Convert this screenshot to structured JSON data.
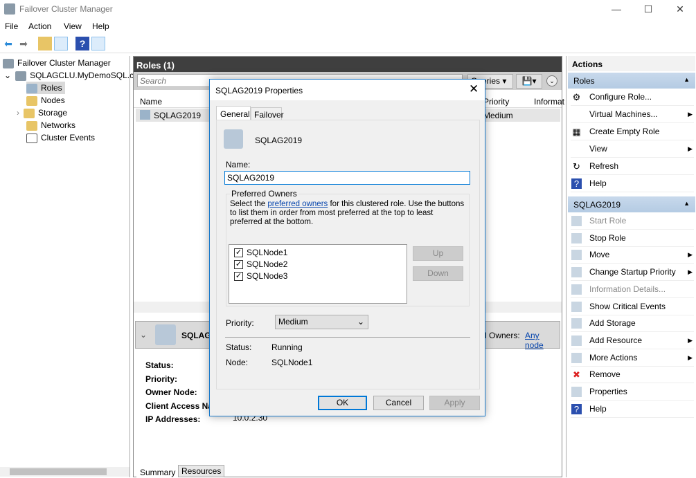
{
  "window": {
    "title": "Failover Cluster Manager",
    "min": "—",
    "max": "☐",
    "close": "✕"
  },
  "menu": [
    "File",
    "Action",
    "View",
    "Help"
  ],
  "tree": {
    "root": "Failover Cluster Manager",
    "cluster": "SQLAGCLU.MyDemoSQL.co",
    "items": [
      "Roles",
      "Nodes",
      "Storage",
      "Networks",
      "Cluster Events"
    ]
  },
  "roles": {
    "header": "Roles (1)",
    "search_placeholder": "Search",
    "queries": "Queries",
    "columns": [
      "Name",
      "Priority",
      "Informat"
    ],
    "rows": [
      {
        "name": "SQLAG2019",
        "priority": "Medium"
      }
    ]
  },
  "detail": {
    "name": "SQLAG2019",
    "owners_label": "d Owners:",
    "owners_link": "Any node",
    "labels": [
      "Status:",
      "Priority:",
      "Owner Node:",
      "Client Access Na",
      "IP Addresses:"
    ],
    "ip": "10.0.2.30",
    "tabs": [
      "Summary",
      "Resources"
    ]
  },
  "dialog": {
    "title": "SQLAG2019 Properties",
    "tabs": [
      "General",
      "Failover"
    ],
    "role_name": "SQLAG2019",
    "name_label": "Name:",
    "name_value": "SQLAG2019",
    "group_label": "Preferred Owners",
    "desc_pre": "Select the ",
    "desc_link": "preferred owners",
    "desc_post": " for this clustered role. Use the buttons to list them in order from most preferred at the top to least preferred at the bottom.",
    "owners": [
      "SQLNode1",
      "SQLNode2",
      "SQLNode3"
    ],
    "up": "Up",
    "down": "Down",
    "priority_label": "Priority:",
    "priority_value": "Medium",
    "status_label": "Status:",
    "status_value": "Running",
    "node_label": "Node:",
    "node_value": "SQLNode1",
    "ok": "OK",
    "cancel": "Cancel",
    "apply": "Apply"
  },
  "actions": {
    "title": "Actions",
    "section1": "Roles",
    "items1": [
      {
        "label": "Configure Role...",
        "icon": "configure-role-icon"
      },
      {
        "label": "Virtual Machines...",
        "sub": true
      },
      {
        "label": "Create Empty Role",
        "icon": "create-role-icon"
      },
      {
        "label": "View",
        "sub": true
      },
      {
        "label": "Refresh",
        "icon": "refresh-icon"
      },
      {
        "label": "Help",
        "icon": "help-icon"
      }
    ],
    "section2": "SQLAG2019",
    "items2": [
      {
        "label": "Start Role",
        "disabled": true
      },
      {
        "label": "Stop Role"
      },
      {
        "label": "Move",
        "sub": true
      },
      {
        "label": "Change Startup Priority",
        "sub": true
      },
      {
        "label": "Information Details...",
        "disabled": true
      },
      {
        "label": "Show Critical Events"
      },
      {
        "label": "Add Storage"
      },
      {
        "label": "Add Resource",
        "sub": true
      },
      {
        "label": "More Actions",
        "sub": true
      },
      {
        "label": "Remove"
      },
      {
        "label": "Properties"
      },
      {
        "label": "Help"
      }
    ]
  }
}
